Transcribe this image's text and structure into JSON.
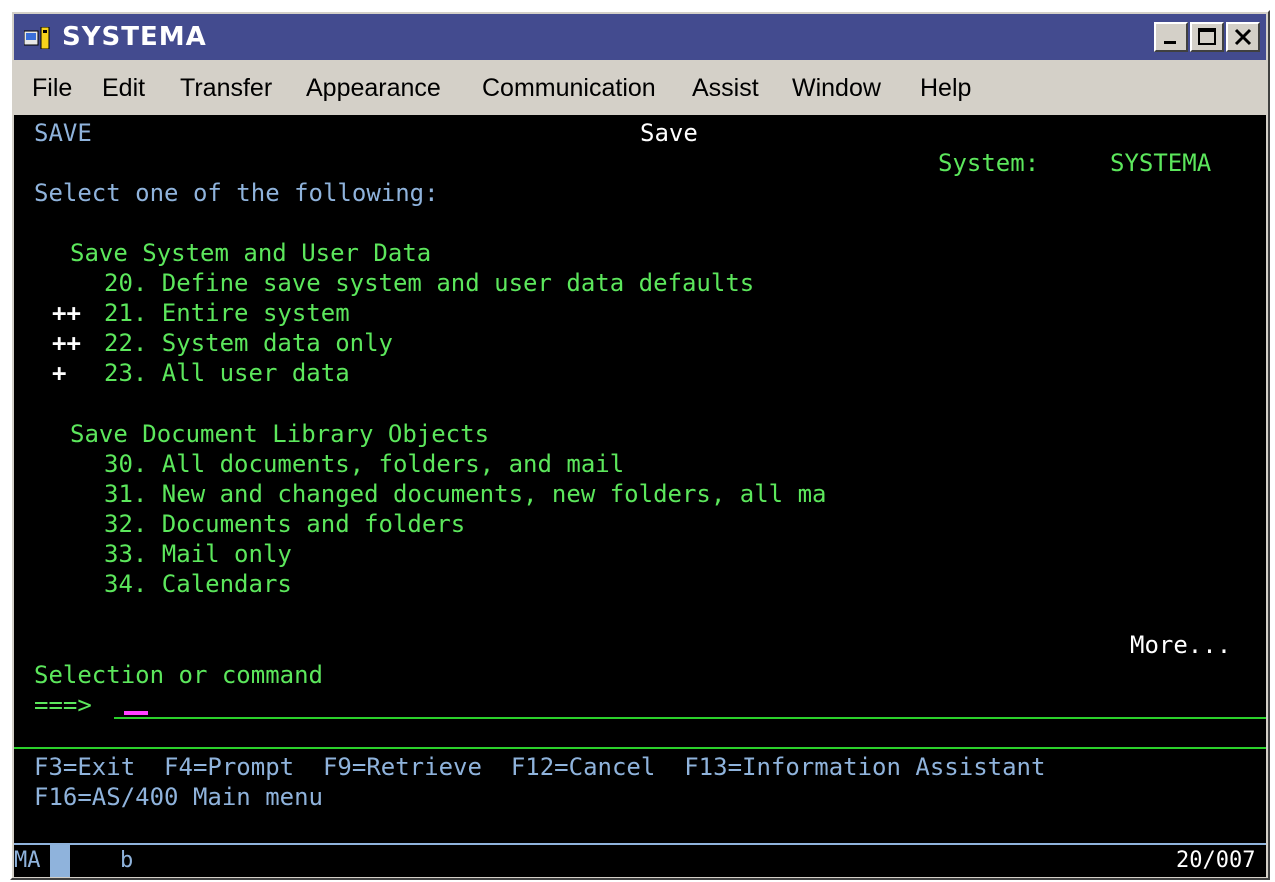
{
  "window": {
    "title": "SYSTEMA",
    "buttons": [
      "minimize",
      "maximize",
      "close"
    ]
  },
  "menubar": {
    "items": [
      {
        "label": "File"
      },
      {
        "label": "Edit"
      },
      {
        "label": "Transfer"
      },
      {
        "label": "Appearance"
      },
      {
        "label": "Communication"
      },
      {
        "label": "Assist"
      },
      {
        "label": "Window"
      },
      {
        "label": "Help"
      }
    ]
  },
  "screen": {
    "menu_id": "SAVE",
    "menu_title": "Save",
    "system_label": "System:",
    "system_name": "SYSTEMA",
    "instruction": "Select one of the following:",
    "section1": {
      "title": "Save System and User Data",
      "options": [
        {
          "marker": "",
          "text": "20. Define save system and user data defaults"
        },
        {
          "marker": "++",
          "text": "21. Entire system"
        },
        {
          "marker": "++",
          "text": "22. System data only"
        },
        {
          "marker": "+",
          "text": "23. All user data"
        }
      ]
    },
    "section2": {
      "title": "Save Document Library Objects",
      "options": [
        {
          "text": "30. All documents, folders, and mail"
        },
        {
          "text": "31. New and changed documents, new folders, all ma"
        },
        {
          "text": "32. Documents and folders"
        },
        {
          "text": "33. Mail only"
        },
        {
          "text": "34. Calendars"
        }
      ]
    },
    "more": "More...",
    "prompt_label": "Selection or command",
    "prompt_arrow": "===>",
    "command_value": "",
    "function_keys_line1": "F3=Exit  F4=Prompt  F9=Retrieve  F12=Cancel  F13=Information Assistant",
    "function_keys_line2": "F16=AS/400 Main menu"
  },
  "oia": {
    "session": "MA",
    "session_letter": "b",
    "cursor_position": "20/007"
  },
  "colors": {
    "titlebar": "#434b8f",
    "screen_bg": "#000000",
    "green_text": "#5ce75c",
    "blue_text": "#8fb3dc",
    "cursor": "#ff40ff"
  }
}
